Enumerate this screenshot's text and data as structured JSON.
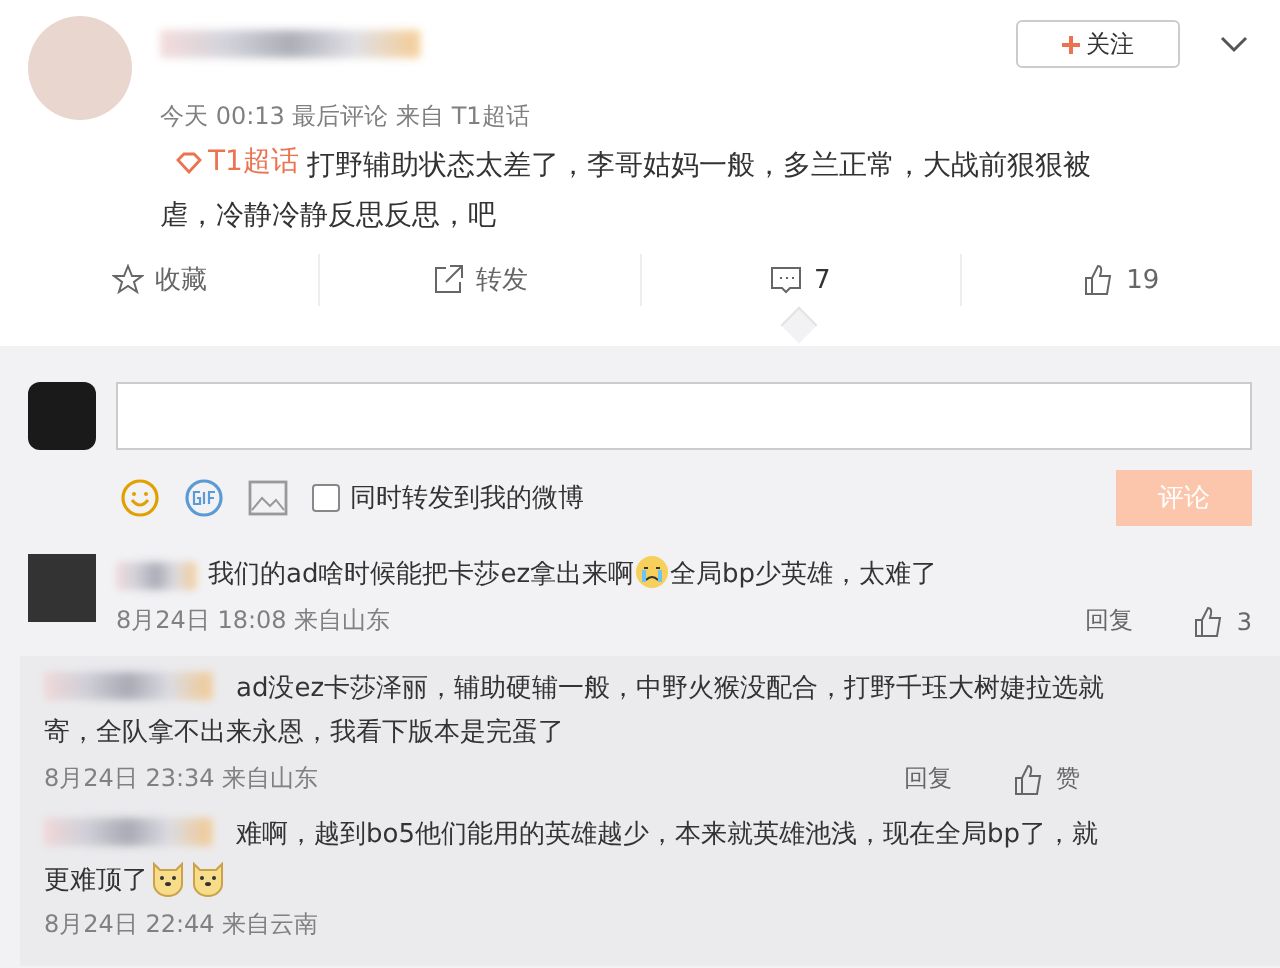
{
  "post": {
    "follow_button": "关注",
    "meta": "今天 00:13 最后评论 来自 T1超话",
    "topic": "T1超话",
    "text": "打野辅助状态太差了，李哥姑妈一般，多兰正常，大战前狠狠被虐，冷静冷静反思反思，吧"
  },
  "actions": [
    {
      "kind": "favorite",
      "label": "收藏",
      "selected": false
    },
    {
      "kind": "repost",
      "label": "转发",
      "selected": false
    },
    {
      "kind": "comment",
      "label": "7",
      "selected": true
    },
    {
      "kind": "like",
      "label": "19",
      "selected": false
    }
  ],
  "composer": {
    "repost_option": {
      "label": "同时转发到我的微博",
      "checked": false
    },
    "submit": "评论",
    "submit_disabled": true
  },
  "comments": [
    {
      "content": [
        {
          "kind": "text",
          "text": "我们的ad啥时候能把卡莎ez拿出来啊"
        },
        {
          "kind": "cry"
        },
        {
          "kind": "text",
          "text": "全局bp少英雄，太难了"
        }
      ],
      "meta": "8月24日 18:08 来自山东",
      "reply": "回复",
      "likes": "3",
      "replies": [
        {
          "content": [
            {
              "kind": "text",
              "text": "ad没ez卡莎泽丽，辅助硬辅一般，中野火猴没配合，打野千珏大树婕拉选就寄，全队拿不出来永恩，我看下版本是完蛋了"
            }
          ],
          "meta": "8月24日 23:34 来自山东",
          "reply": "回复",
          "likes": "赞"
        },
        {
          "content": [
            {
              "kind": "text",
              "text": "难啊，越到bo5他们能用的英雄越少，本来就英雄池浅，现在全局bp了，就更难顶了"
            },
            {
              "kind": "doge"
            },
            {
              "kind": "doge"
            }
          ],
          "meta": "8月24日 22:44 来自云南"
        }
      ]
    }
  ]
}
